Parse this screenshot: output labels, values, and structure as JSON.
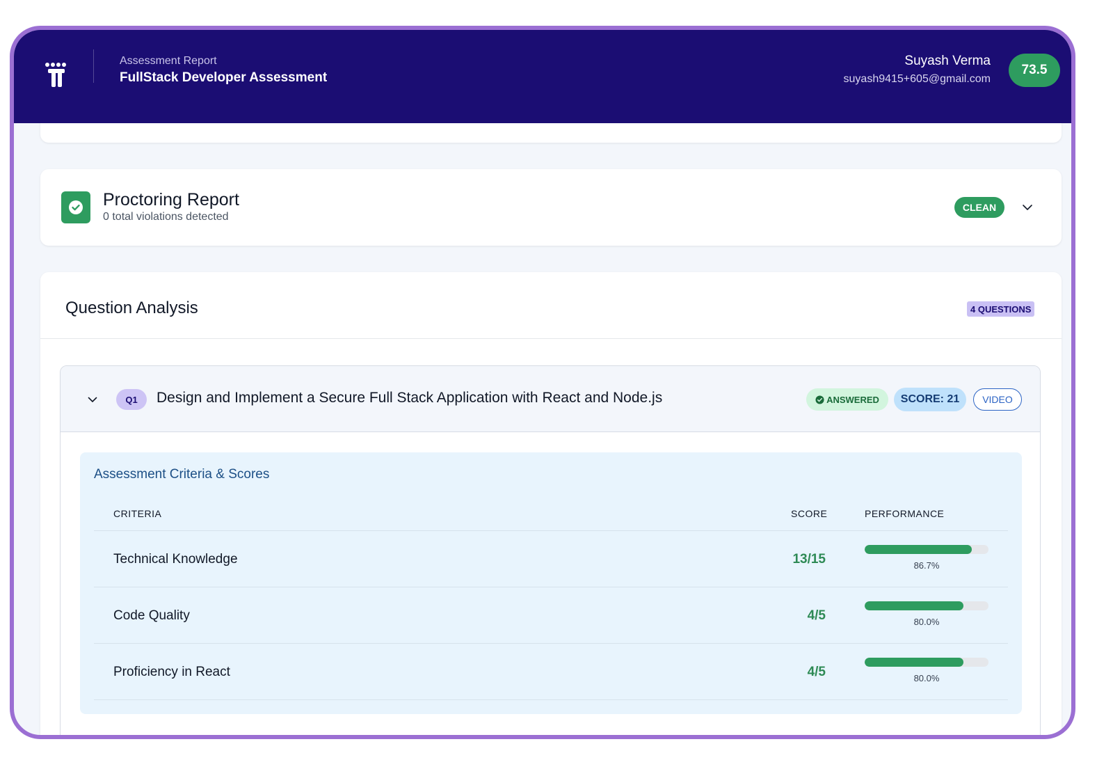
{
  "header": {
    "subtitle": "Assessment Report",
    "title": "FullStack Developer Assessment",
    "user_name": "Suyash Verma",
    "user_email": "suyash9415+605@gmail.com",
    "overall_score": "73.5",
    "brand_color": "#1b0d73",
    "logo_icon": "logo-icon"
  },
  "proctoring": {
    "title": "Proctoring Report",
    "subtitle": "0 total violations detected",
    "status": "CLEAN",
    "status_color": "#2e9c5f",
    "icon": "check-circle-icon"
  },
  "question_analysis": {
    "title": "Question Analysis",
    "count_label": "4 QUESTIONS",
    "questions": [
      {
        "tag": "Q1",
        "title": "Design and Implement a Secure Full Stack Application with React and Node.js",
        "answered_label": "ANSWERED",
        "score_label": "SCORE: 21",
        "video_label": "VIDEO",
        "criteria_panel": {
          "title": "Assessment Criteria & Scores",
          "headers": {
            "criteria": "CRITERIA",
            "score": "SCORE",
            "performance": "PERFORMANCE"
          },
          "rows": [
            {
              "name": "Technical Knowledge",
              "score": "13/15",
              "percent_label": "86.7%",
              "percent": 86.7
            },
            {
              "name": "Code Quality",
              "score": "4/5",
              "percent_label": "80.0%",
              "percent": 80.0
            },
            {
              "name": "Proficiency in React",
              "score": "4/5",
              "percent_label": "80.0%",
              "percent": 80.0
            }
          ]
        }
      }
    ]
  }
}
